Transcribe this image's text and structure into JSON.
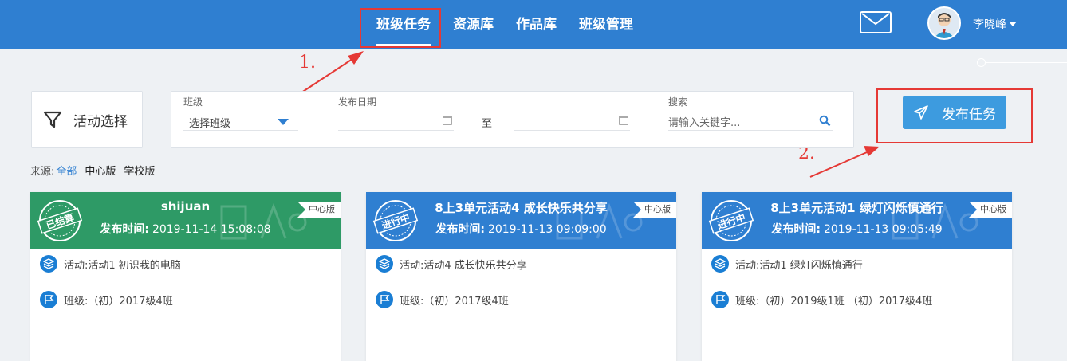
{
  "nav": {
    "items": [
      {
        "label": "班级任务",
        "active": true
      },
      {
        "label": "资源库",
        "active": false
      },
      {
        "label": "作品库",
        "active": false
      },
      {
        "label": "班级管理",
        "active": false
      }
    ]
  },
  "user": {
    "name": "李晓峰"
  },
  "annotations": {
    "step1": "1.",
    "step2": "2."
  },
  "toolbar": {
    "filter_label": "活动选择",
    "publish_label": "发布任务"
  },
  "filters": {
    "class_label": "班级",
    "class_value": "选择班级",
    "date_label": "发布日期",
    "date_separator": "至",
    "search_label": "搜索",
    "search_placeholder": "请输入关键字..."
  },
  "source": {
    "label": "来源:",
    "options": [
      "全部",
      "中心版",
      "学校版"
    ],
    "selected": "全部"
  },
  "cards": [
    {
      "title": "shijuan",
      "time_label": "发布时间:",
      "time": "2019-11-14 15:08:08",
      "tag": "中心版",
      "status": "已结算",
      "header_color": "#2e9a66",
      "activity_label": "活动:",
      "activity": "活动1 初识我的电脑",
      "class_label": "班级:",
      "class": "（初）2017级4班"
    },
    {
      "title": "8上3单元活动4 成长快乐共分享",
      "time_label": "发布时间:",
      "time": "2019-11-13 09:09:00",
      "tag": "中心版",
      "status": "进行中",
      "header_color": "#2f7fd1",
      "activity_label": "活动:",
      "activity": "活动4 成长快乐共分享",
      "class_label": "班级:",
      "class": "（初）2017级4班"
    },
    {
      "title": "8上3单元活动1 绿灯闪烁慎通行",
      "time_label": "发布时间:",
      "time": "2019-11-13 09:05:49",
      "tag": "中心版",
      "status": "进行中",
      "header_color": "#2f7fd1",
      "activity_label": "活动:",
      "activity": "活动1 绿灯闪烁慎通行",
      "class_label": "班级:",
      "class": "（初）2019级1班 （初）2017级4班"
    }
  ],
  "colors": {
    "brand": "#2f7fd1",
    "accent": "#3d9bdf",
    "highlight": "#e53935",
    "finished": "#2e9a66"
  }
}
